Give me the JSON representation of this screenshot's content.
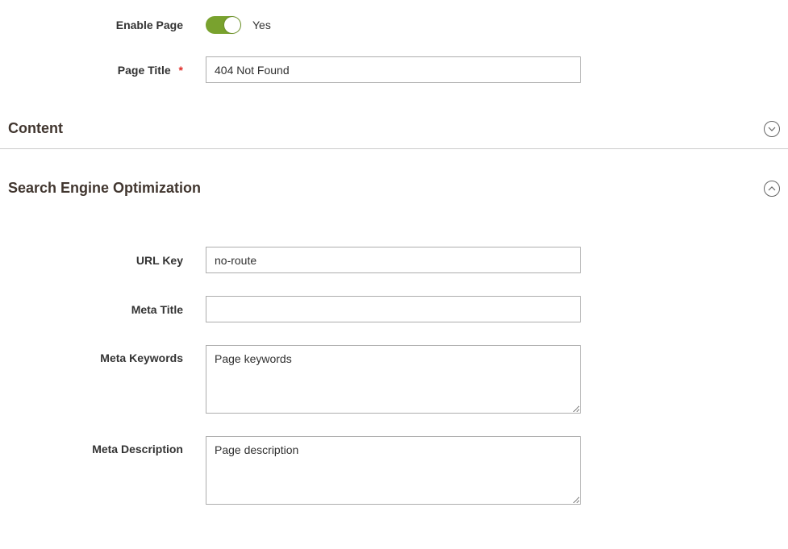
{
  "general": {
    "enable_page_label": "Enable Page",
    "enable_page_value": "Yes",
    "page_title_label": "Page Title",
    "page_title_value": "404 Not Found"
  },
  "sections": {
    "content": {
      "title": "Content",
      "expanded": false
    },
    "seo": {
      "title": "Search Engine Optimization",
      "expanded": true,
      "fields": {
        "url_key_label": "URL Key",
        "url_key_value": "no-route",
        "meta_title_label": "Meta Title",
        "meta_title_value": "",
        "meta_keywords_label": "Meta Keywords",
        "meta_keywords_value": "Page keywords",
        "meta_description_label": "Meta Description",
        "meta_description_value": "Page description"
      }
    }
  }
}
